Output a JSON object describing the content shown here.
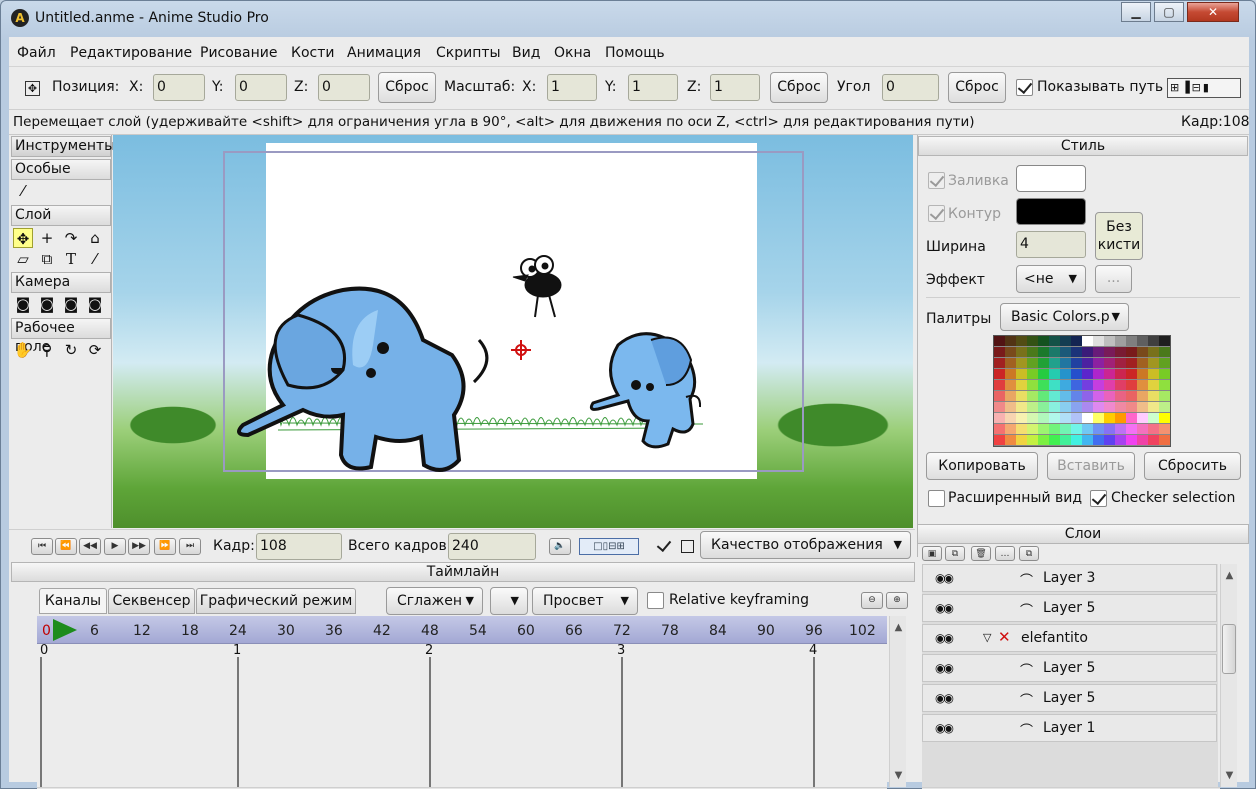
{
  "window": {
    "title": "Untitled.anme - Anime Studio Pro",
    "app_icon_letter": "A",
    "min_label": "▁",
    "max_label": "▢",
    "close_label": "✕"
  },
  "menu": [
    "Файл",
    "Редактирование",
    "Рисование",
    "Кости",
    "Анимация",
    "Скрипты",
    "Вид",
    "Окна",
    "Помощь"
  ],
  "toolbar": {
    "position_label": "Позиция:",
    "x_label": "X:",
    "y_label": "Y:",
    "z_label": "Z:",
    "pos_x": "0",
    "pos_y": "0",
    "pos_z": "0",
    "reset_label": "Сброс",
    "scale_label": "Масштаб:",
    "scale_x": "1",
    "scale_y": "1",
    "scale_z": "1",
    "angle_label": "Угол",
    "angle": "0",
    "show_path_label": "Показывать путь",
    "show_path_checked": true
  },
  "status": {
    "hint": "Перемещает слой (удерживайте <shift> для ограничения угла в 90°, <alt> для движения по оси Z, <ctrl> для редактирования пути)",
    "frame": "Кадр:108"
  },
  "tools": {
    "header": "Инструменты",
    "sections": [
      "Особые",
      "Слой",
      "Камера",
      "Рабочее поле"
    ]
  },
  "playback": {
    "frame_label": "Кадр:",
    "frame_value": "108",
    "total_label": "Всего кадров:",
    "total_value": "240",
    "quality_label": "Качество отображения"
  },
  "timeline": {
    "header": "Таймлайн",
    "tabs": [
      "Каналы",
      "Секвенсер",
      "Графический режим"
    ],
    "smooth_label": "Сглажен",
    "onion_label": "Просвет",
    "relative_label": "Relative keyframing",
    "ruler_ticks": [
      "0",
      "6",
      "12",
      "18",
      "24",
      "30",
      "36",
      "42",
      "48",
      "54",
      "60",
      "66",
      "72",
      "78",
      "84",
      "90",
      "96",
      "102"
    ],
    "second_ticks": [
      "0",
      "1",
      "2",
      "3",
      "4"
    ]
  },
  "style": {
    "header": "Стиль",
    "fill_label": "Заливка",
    "stroke_label": "Контур",
    "width_label": "Ширина",
    "width_value": "4",
    "no_brush_label": "Без кисти",
    "effect_label": "Эффект",
    "effect_value": "<не",
    "effect_more": "...",
    "palettes_label": "Палитры",
    "palette_value": "Basic Colors.p",
    "copy_label": "Копировать",
    "paste_label": "Вставить",
    "reset_label": "Сбросить",
    "advanced_label": "Расширенный вид",
    "checker_label": "Checker selection",
    "fill_color": "#ffffff",
    "stroke_color": "#000000"
  },
  "layers": {
    "header": "Слои",
    "rows": [
      {
        "name": "Layer 3",
        "type": "vector"
      },
      {
        "name": "Layer 5",
        "type": "vector"
      },
      {
        "name": "elefantito",
        "type": "group"
      },
      {
        "name": "Layer 5",
        "type": "vector"
      },
      {
        "name": "Layer 5",
        "type": "vector"
      },
      {
        "name": "Layer 1",
        "type": "vector"
      }
    ]
  }
}
